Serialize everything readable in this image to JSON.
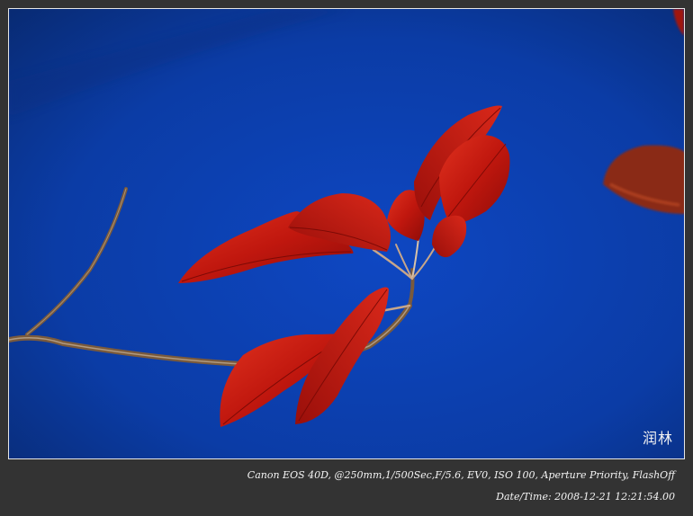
{
  "photo": {
    "subject": "red leaves on a bare twig against blue sky",
    "sky_color": "#0c3fae",
    "leaf_color": "#c0170e",
    "branch_color": "#7a5a3c"
  },
  "watermark": "润林",
  "caption": {
    "exif": "Canon EOS 40D,  @250mm,1/500Sec,F/5.6, EV0, ISO 100, Aperture Priority, FlashOff",
    "datetime": "Date/Time: 2008-12-21 12:21:54.00"
  }
}
